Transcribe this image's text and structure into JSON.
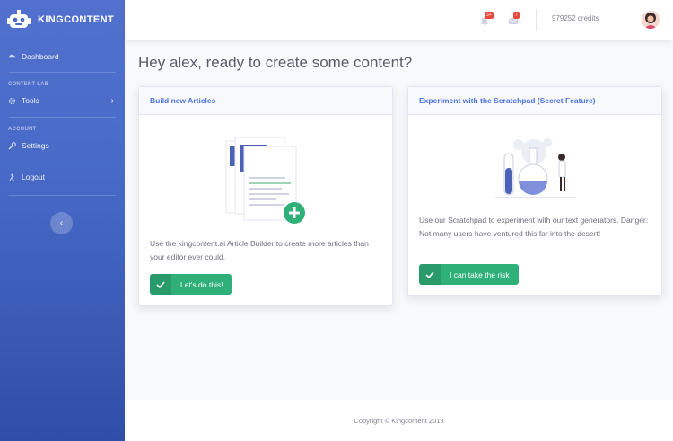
{
  "brand": {
    "name": "KINGCONTENT",
    "logo_icon": "robot-logo-icon"
  },
  "sidebar": {
    "dashboard": {
      "label": "Dashboard",
      "icon": "dashboard-icon"
    },
    "section_content_lab": "CONTENT LAB",
    "tools": {
      "label": "Tools",
      "icon": "cog-icon"
    },
    "section_account": "ACCOUNT",
    "settings": {
      "label": "Settings",
      "icon": "wrench-icon"
    },
    "logout": {
      "label": "Logout",
      "icon": "logout-icon"
    },
    "toggle_label": "‹"
  },
  "topbar": {
    "alerts_badge": "3+",
    "messages_badge": "7",
    "credits": "979252 credits"
  },
  "greeting": "Hey alex, ready to create some content?",
  "cards": {
    "articles": {
      "title": "Build new Articles",
      "text": "Use the kingcontent.ai Article Builder to create more articles than your editor ever could.",
      "button": "Let's do this!"
    },
    "scratchpad": {
      "title": "Experiment with the Scratchpad (Secret Feature)",
      "text": "Use our Scratchpad to experiment with our text generators. Danger: Not many users have ventured this far into the desert!",
      "button": "I can take the risk"
    }
  },
  "footer": {
    "copyright": "Copyright © Kingcontent 2019"
  },
  "colors": {
    "primary": "#4e73df",
    "success": "#2fb079",
    "danger": "#e74a3b"
  }
}
